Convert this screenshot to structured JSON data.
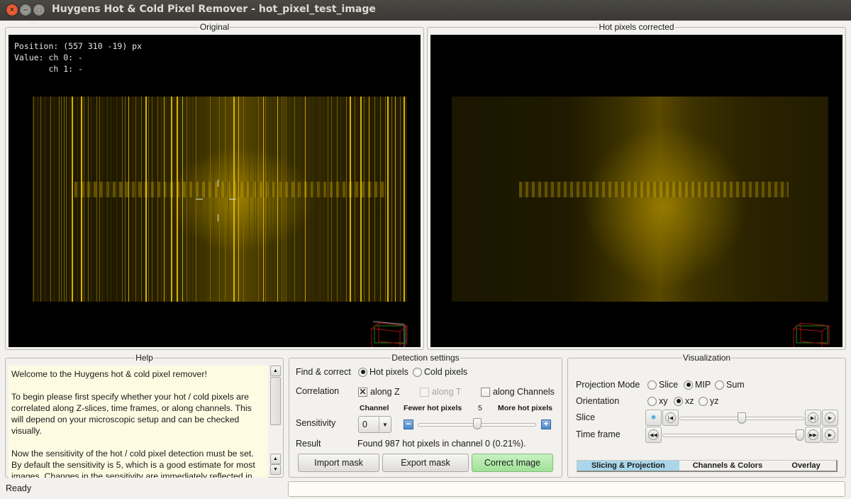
{
  "window": {
    "title": "Huygens Hot & Cold Pixel Remover - hot_pixel_test_image",
    "controls": [
      "close",
      "minimize",
      "maximize"
    ]
  },
  "original_panel": {
    "title": "Original",
    "overlay": {
      "position_line": "Position: (557 310 -19) px",
      "value_line_0": "Value: ch 0: -",
      "value_line_1": "       ch 1: -"
    }
  },
  "corrected_panel": {
    "title": "Hot pixels corrected"
  },
  "help": {
    "title": "Help",
    "paragraphs": [
      "Welcome to the Huygens hot & cold pixel  remover!",
      "To begin please first specify whether your hot / cold pixels are correlated along Z-slices, time frames, or along channels. This will depend on your microscopic setup and can be checked visually.",
      "Now the sensitivity of the hot / cold pixel detection must be set. By default the sensitivity is 5, which is a good estimate for most images. Changes in the sensitivity are immediately reflected in the corrected image, indicating whether the detection works well."
    ]
  },
  "detection": {
    "title": "Detection settings",
    "find_label": "Find & correct",
    "find_options": [
      {
        "label": "Hot pixels",
        "selected": true
      },
      {
        "label": "Cold pixels",
        "selected": false
      }
    ],
    "correlation_label": "Correlation",
    "correlation_options": [
      {
        "label": "along Z",
        "checked": true,
        "enabled": true
      },
      {
        "label": "along T",
        "checked": false,
        "enabled": false
      },
      {
        "label": "along Channels",
        "checked": false,
        "enabled": true
      }
    ],
    "channel_header": "Channel",
    "fewer_label": "Fewer hot pixels",
    "more_label": "More hot pixels",
    "sensitivity_value": "5",
    "sensitivity_label": "Sensitivity",
    "channel_value": "0",
    "sensitivity_fraction": 0.5,
    "result_label": "Result",
    "result_text": "Found 987 hot pixels in  channel 0 (0.21%).",
    "buttons": {
      "import": "Import mask",
      "export": "Export mask",
      "correct": "Correct Image"
    }
  },
  "visualization": {
    "title": "Visualization",
    "projection_label": "Projection Mode",
    "projection_options": [
      {
        "label": "Slice",
        "selected": false
      },
      {
        "label": "MIP",
        "selected": true
      },
      {
        "label": "Sum",
        "selected": false
      }
    ],
    "orientation_label": "Orientation",
    "orientation_options": [
      {
        "label": "xy",
        "selected": false
      },
      {
        "label": "xz",
        "selected": true
      },
      {
        "label": "yz",
        "selected": false
      }
    ],
    "slice_label": "Slice",
    "slice_fraction": 0.5,
    "timeframe_label": "Time frame",
    "timeframe_fraction": 1.0,
    "tabs": [
      {
        "label": "Slicing & Projection",
        "active": true
      },
      {
        "label": "Channels & Colors",
        "active": false
      },
      {
        "label": "Overlay",
        "active": false
      }
    ]
  },
  "status": {
    "text": "Ready",
    "field_value": ""
  },
  "colors": {
    "image_tint": "#c8a800",
    "correct_button": "#a6e49e",
    "active_tab": "#a9d6ea",
    "help_bg": "#fdfbe2"
  }
}
